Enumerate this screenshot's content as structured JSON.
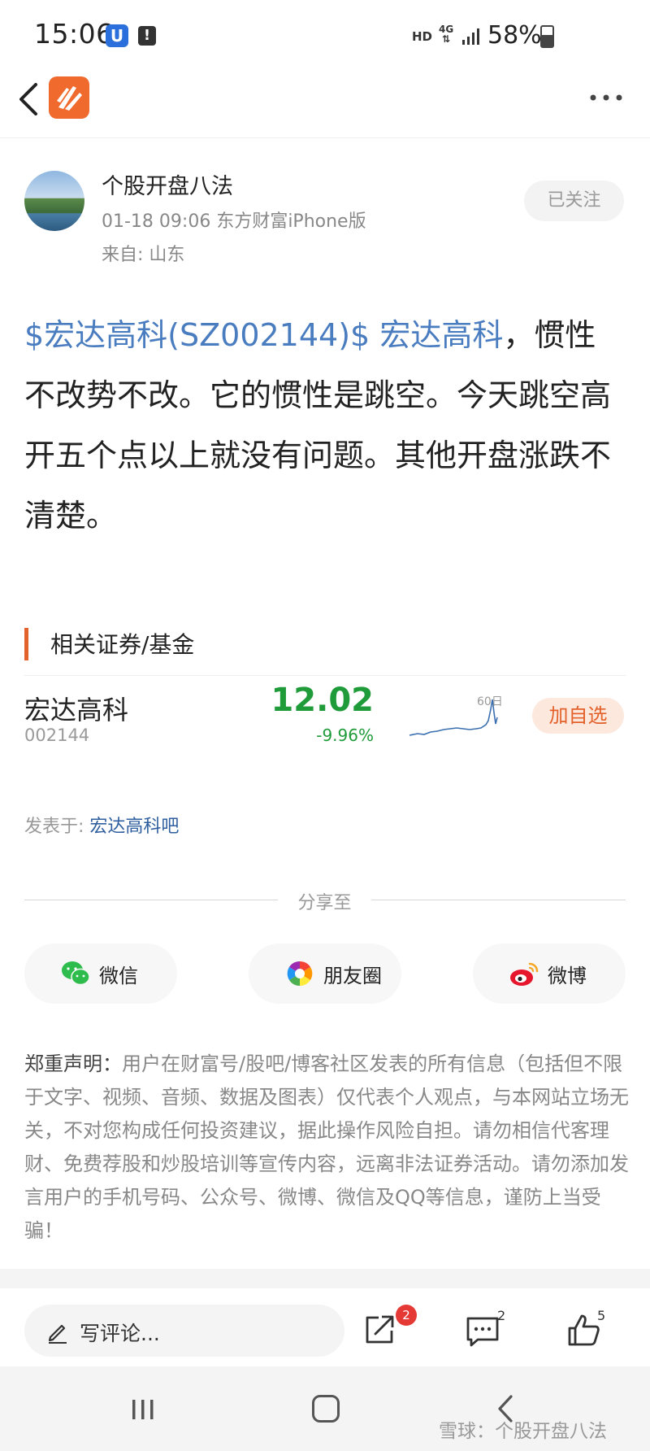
{
  "status_bar": {
    "time": "15:06",
    "app_badge": "U",
    "alert_badge": "!",
    "network_hd": "HD",
    "network_4g": "4G",
    "battery": "58%",
    "battery_level": 0.58
  },
  "nav": {
    "back_icon": "chevron-left-icon",
    "logo_icon": "eastmoney-logo-icon",
    "more_icon": "more-dots-icon"
  },
  "author": {
    "name": "个股开盘八法",
    "meta": "01-18 09:06 东方财富iPhone版",
    "location": "来自: 山东",
    "follow_label": "已关注"
  },
  "post": {
    "tag_stock": "$宏达高科(SZ002144)$",
    "tag_name": "宏达高科",
    "text_sep": "，",
    "body": "惯性不改势不改。它的惯性是跳空。今天跳空高开五个点以上就没有问题。其他开盘涨跌不清楚。"
  },
  "related": {
    "title": "相关证券/基金",
    "stock": {
      "name": "宏达高科",
      "code": "002144",
      "price": "12.02",
      "change": "-9.96%",
      "sparkline_label": "60日",
      "add_label": "加自选"
    }
  },
  "posted_in": {
    "prefix": "发表于: ",
    "bar": "宏达高科吧"
  },
  "share": {
    "label": "分享至",
    "items": [
      {
        "label": "微信",
        "icon": "wechat-icon"
      },
      {
        "label": "朋友圈",
        "icon": "moments-icon"
      },
      {
        "label": "微博",
        "icon": "weibo-icon"
      }
    ]
  },
  "disclaimer": {
    "head": "郑重声明：",
    "body": "用户在财富号/股吧/博客社区发表的所有信息（包括但不限于文字、视频、音频、数据及图表）仅代表个人观点，与本网站立场无关，不对您构成任何投资建议，据此操作风险自担。请勿相信代客理财、免费荐股和炒股培训等宣传内容，远离非法证券活动。请勿添加发言用户的手机号码、公众号、微博、微信及QQ等信息，谨防上当受骗！"
  },
  "bottom_bar": {
    "comment_placeholder": "写评论...",
    "share_badge": "2",
    "comment_count": "2",
    "like_count": "5"
  },
  "system_nav": {
    "watermark": "雪球：个股开盘八法"
  },
  "colors": {
    "accent": "#e3612a",
    "link": "#4a7cc0",
    "down": "#1f9b3a",
    "badge": "#e53935"
  }
}
